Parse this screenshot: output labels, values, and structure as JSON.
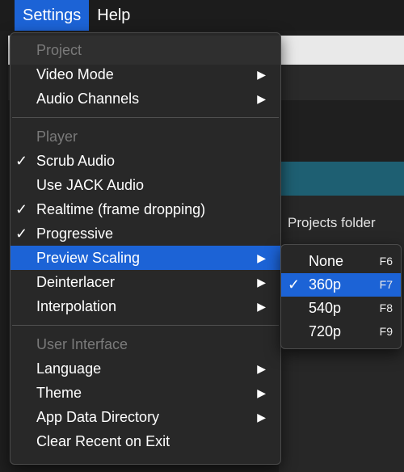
{
  "menubar": {
    "items": [
      {
        "label": "Settings",
        "active": true
      },
      {
        "label": "Help",
        "active": false
      }
    ]
  },
  "background": {
    "projects_folder": "Projects folder"
  },
  "settings_menu": {
    "sections": [
      {
        "header": "Project",
        "items": [
          {
            "label": "Video Mode",
            "checked": false,
            "submenu": true,
            "icon": "arrow-right-icon"
          },
          {
            "label": "Audio Channels",
            "checked": false,
            "submenu": true,
            "icon": "arrow-right-icon"
          }
        ]
      },
      {
        "header": "Player",
        "items": [
          {
            "label": "Scrub Audio",
            "checked": true,
            "submenu": false
          },
          {
            "label": "Use JACK Audio",
            "checked": false,
            "submenu": false
          },
          {
            "label": "Realtime (frame dropping)",
            "checked": true,
            "submenu": false
          },
          {
            "label": "Progressive",
            "checked": true,
            "submenu": false
          },
          {
            "label": "Preview Scaling",
            "checked": false,
            "submenu": true,
            "highlighted": true
          },
          {
            "label": "Deinterlacer",
            "checked": false,
            "submenu": true
          },
          {
            "label": "Interpolation",
            "checked": false,
            "submenu": true
          }
        ]
      },
      {
        "header": "User Interface",
        "items": [
          {
            "label": "Language",
            "checked": false,
            "submenu": true
          },
          {
            "label": "Theme",
            "checked": false,
            "submenu": true
          },
          {
            "label": "App Data Directory",
            "checked": false,
            "submenu": true
          },
          {
            "label": "Clear Recent on Exit",
            "checked": false,
            "submenu": false
          }
        ]
      }
    ],
    "check_glyph": "✓",
    "arrow_glyph": "▶"
  },
  "preview_scaling_submenu": {
    "items": [
      {
        "label": "None",
        "shortcut": "F6",
        "checked": false
      },
      {
        "label": "360p",
        "shortcut": "F7",
        "checked": true,
        "highlighted": true
      },
      {
        "label": "540p",
        "shortcut": "F8",
        "checked": false
      },
      {
        "label": "720p",
        "shortcut": "F9",
        "checked": false
      }
    ]
  },
  "colors": {
    "highlight": "#1c63d6",
    "menu_bg": "#282828",
    "disabled_text": "#7a7a7a",
    "teal_bar": "#1e5f72"
  }
}
